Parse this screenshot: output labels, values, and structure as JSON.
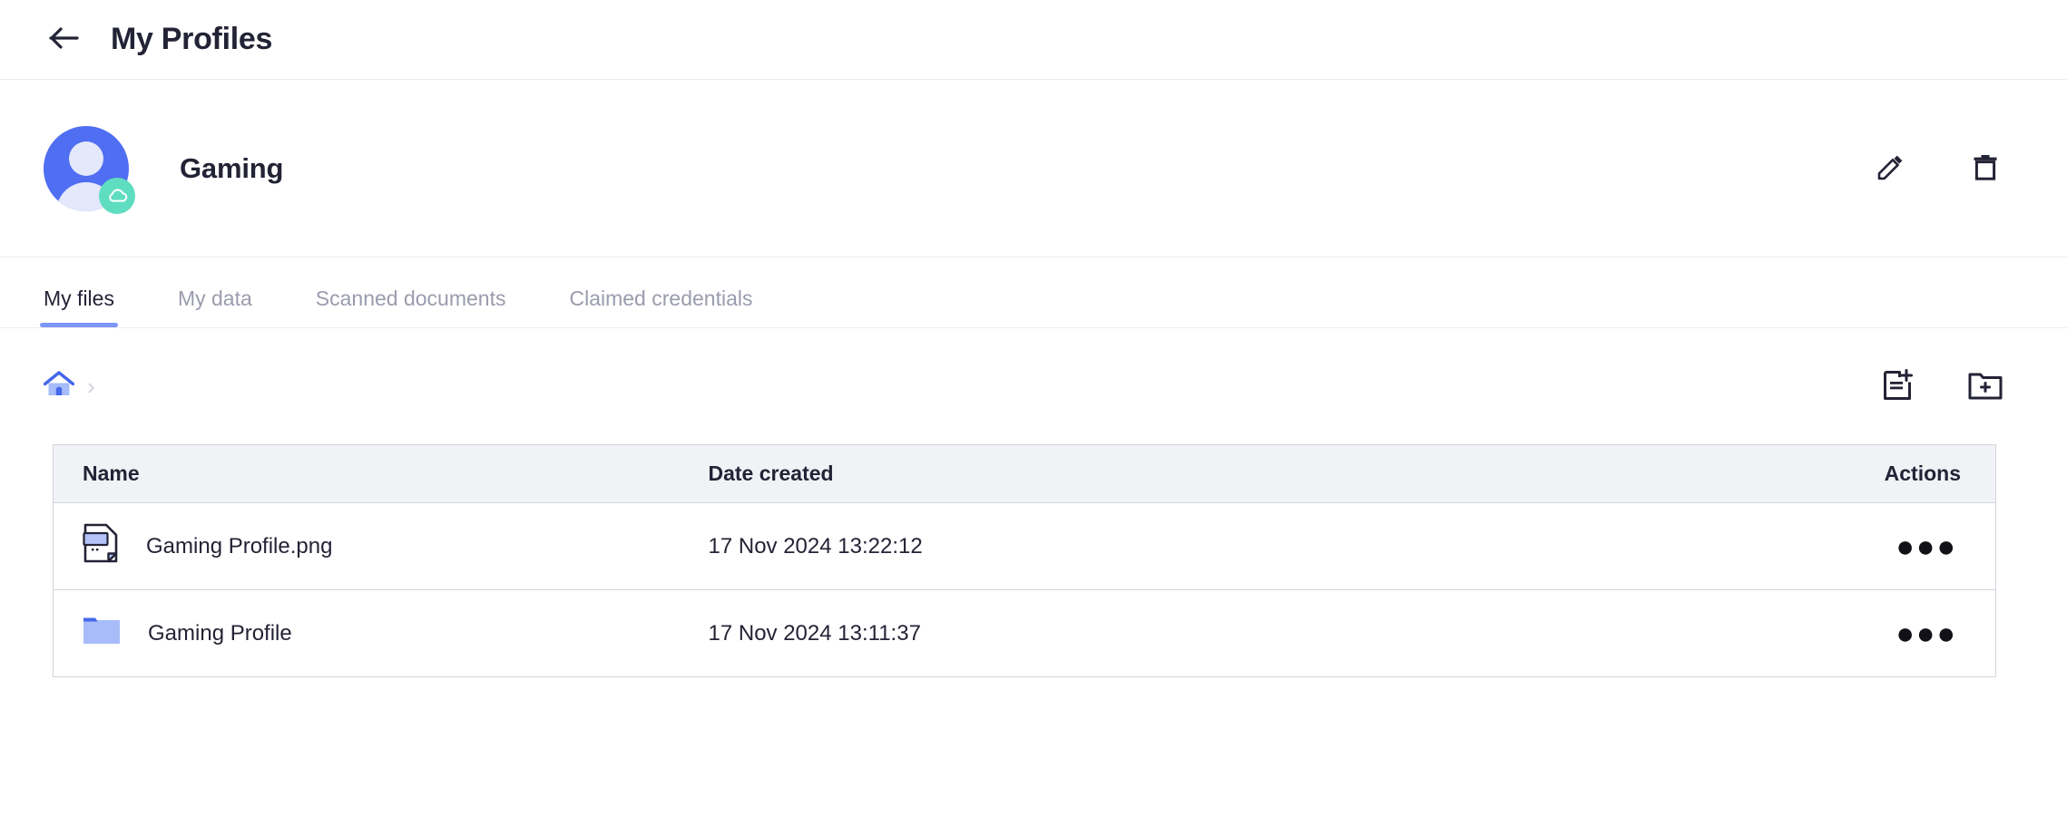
{
  "header": {
    "back_icon": "arrow-left-icon",
    "title": "My Profiles"
  },
  "profile": {
    "name": "Gaming",
    "avatar_icon": "user-avatar-icon",
    "badge_icon": "cloud-icon",
    "edit_icon": "pencil-icon",
    "delete_icon": "trash-icon",
    "colors": {
      "avatar_blue": "#4F6EF2",
      "avatar_silhouette": "#E4E8FB",
      "cloud_badge": "#5FDDC0"
    }
  },
  "tabs": [
    {
      "label": "My files",
      "active": true
    },
    {
      "label": "My data",
      "active": false
    },
    {
      "label": "Scanned documents",
      "active": false
    },
    {
      "label": "Claimed credentials",
      "active": false
    }
  ],
  "breadcrumb": {
    "home_icon": "home-icon",
    "separator": "›"
  },
  "toolbar": {
    "add_file_icon": "add-file-icon",
    "add_folder_icon": "add-folder-icon"
  },
  "table": {
    "columns": [
      "Name",
      "Date created",
      "Actions"
    ],
    "rows": [
      {
        "icon": "image-file-icon",
        "name": "Gaming Profile.png",
        "date_created": "17 Nov 2024 13:22:12",
        "actions_label": "●●●"
      },
      {
        "icon": "folder-icon",
        "name": "Gaming Profile",
        "date_created": "17 Nov 2024 13:11:37",
        "actions_label": "●●●"
      }
    ]
  },
  "colors": {
    "accent": "#7B96F5",
    "text_primary": "#232336",
    "text_muted": "#9A9CAD",
    "border": "#D3D5DE",
    "header_bg": "#F1F2F6"
  }
}
